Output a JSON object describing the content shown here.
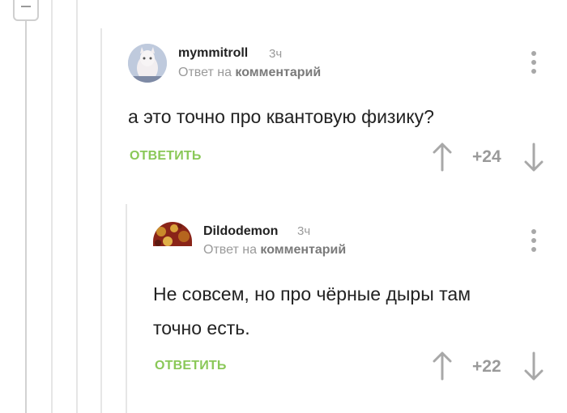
{
  "comments": [
    {
      "username": "mymmitroll",
      "time": "3ч",
      "reply_prefix": "Ответ на",
      "reply_target": "комментарий",
      "text": "а это точно про квантовую физику?",
      "reply_label": "ОТВЕТИТЬ",
      "rating": "+24"
    },
    {
      "username": "Dildodemon",
      "time": "3ч",
      "reply_prefix": "Ответ на",
      "reply_target": "комментарий",
      "text_line1": "Не совсем, но про чёрные дыры там",
      "text_line2": "точно есть.",
      "reply_label": "ОТВЕТИТЬ",
      "rating": "+22"
    }
  ],
  "colors": {
    "accent": "#8ac858",
    "muted": "#9a9a9a",
    "thread_line": "#e6e6e6"
  },
  "icons": [
    "minus-icon",
    "more-vertical-icon",
    "arrow-up-icon",
    "arrow-down-icon"
  ]
}
